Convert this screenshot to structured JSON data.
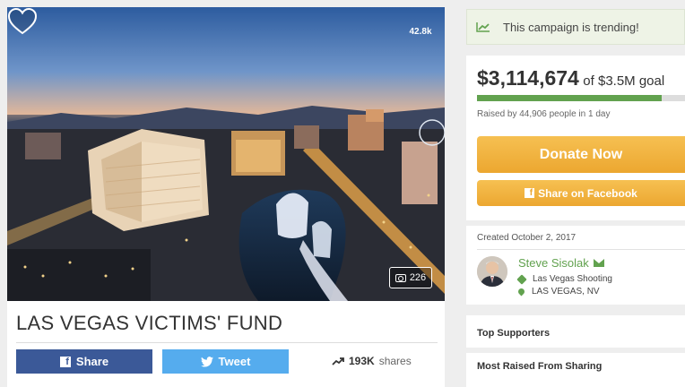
{
  "campaign": {
    "title": "LAS VEGAS VICTIMS' FUND",
    "hearts": "42.8k",
    "photo_count": "226"
  },
  "social": {
    "share_label": "Share",
    "tweet_label": "Tweet",
    "shares_count": "193K",
    "shares_label": "shares"
  },
  "trending": {
    "text": "This campaign is trending!"
  },
  "donation": {
    "raised": "$3,114,674",
    "goal_text": "of $3.5M goal",
    "progress_fraction": 0.89,
    "raised_by": "Raised by 44,906 people in 1 day",
    "donate_label": "Donate Now",
    "facebook_label": "Share on Facebook"
  },
  "organizer": {
    "created": "Created October 2, 2017",
    "name": "Steve Sisolak",
    "category": "Las Vegas Shooting",
    "location": "LAS VEGAS, NV"
  },
  "sections": {
    "top_supporters": "Top Supporters",
    "most_raised": "Most Raised From Sharing"
  },
  "colors": {
    "accent_green": "#62a24f",
    "donate_orange": "#eca730",
    "facebook_blue": "#3b5998",
    "twitter_blue": "#55acee"
  }
}
